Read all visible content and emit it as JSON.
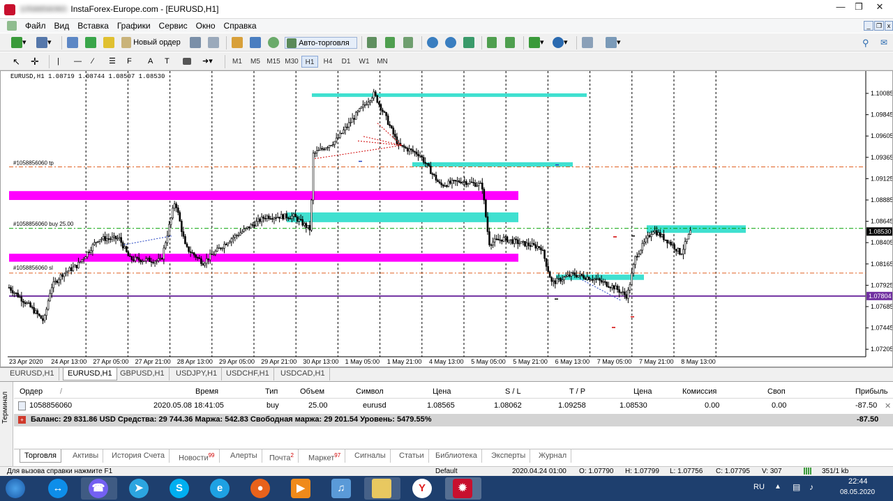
{
  "window": {
    "title": "InstaForex-Europe.com - [EURUSD,H1]",
    "account_prefix": "1058856060:"
  },
  "menu": [
    "Файл",
    "Вид",
    "Вставка",
    "Графики",
    "Сервис",
    "Окно",
    "Справка"
  ],
  "toolbar": {
    "new_order": "Новый ордер",
    "autotrade": "Авто-торговля"
  },
  "timeframes": [
    "M1",
    "M5",
    "M15",
    "M30",
    "H1",
    "H4",
    "D1",
    "W1",
    "MN"
  ],
  "active_timeframe": "H1",
  "chart": {
    "header": "EURUSD,H1  1.08719 1.08744 1.08507 1.08530",
    "price_axis": [
      "1.10085",
      "1.09845",
      "1.09605",
      "1.09365",
      "1.09125",
      "1.08885",
      "1.08645",
      "1.08405",
      "1.08165",
      "1.07925",
      "1.07685",
      "1.07445",
      "1.07205"
    ],
    "time_axis": [
      "23 Apr 2020",
      "24 Apr 13:00",
      "27 Apr 05:00",
      "27 Apr 21:00",
      "28 Apr 13:00",
      "29 Apr 05:00",
      "29 Apr 21:00",
      "30 Apr 13:00",
      "1 May 05:00",
      "1 May 21:00",
      "4 May 13:00",
      "5 May 05:00",
      "5 May 21:00",
      "6 May 13:00",
      "7 May 05:00",
      "7 May 21:00",
      "8 May 13:00"
    ],
    "current_price": "1.08530",
    "level_price": "1.07804",
    "order_tp_label": "#1058856060 tp",
    "order_buy_label": "#1058856060 buy 25.00",
    "order_sl_label": "#1058856060 sl",
    "colors": {
      "bull": "#00aa00",
      "bear": "#d00000",
      "zone_cyan": "#40e0d0",
      "zone_magenta": "#ff00ff",
      "level": "#7030a0",
      "tp_line": "#e06020",
      "entry_line": "#00a000"
    }
  },
  "chart_tabs": [
    "EURUSD,H1",
    "EURUSD,H1",
    "GBPUSD,H1",
    "USDJPY,H1",
    "USDCHF,H1",
    "USDCAD,H1"
  ],
  "active_chart_tab": 1,
  "terminal": {
    "label": "Терминал",
    "headers": {
      "order": "Ордер",
      "time": "Время",
      "type": "Тип",
      "volume": "Объем",
      "symbol": "Символ",
      "price": "Цена",
      "sl": "S / L",
      "tp": "T / P",
      "price_now": "Цена",
      "commission": "Комиссия",
      "swap": "Своп",
      "profit": "Прибыль"
    },
    "row": {
      "order": "1058856060",
      "time": "2020.05.08 18:41:05",
      "type": "buy",
      "volume": "25.00",
      "symbol": "eurusd",
      "price": "1.08565",
      "sl": "1.08062",
      "tp": "1.09258",
      "price_now": "1.08530",
      "commission": "0.00",
      "swap": "0.00",
      "profit": "-87.50"
    },
    "balance_text": "Баланс: 29 831.86 USD  Средства: 29 744.36  Маржа: 542.83  Свободная маржа: 29 201.54  Уровень: 5479.55%",
    "balance_profit": "-87.50",
    "tabs": [
      {
        "label": "Торговля",
        "badge": ""
      },
      {
        "label": "Активы",
        "badge": ""
      },
      {
        "label": "История Счета",
        "badge": ""
      },
      {
        "label": "Новости",
        "badge": "99"
      },
      {
        "label": "Алерты",
        "badge": ""
      },
      {
        "label": "Почта",
        "badge": "2"
      },
      {
        "label": "Маркет",
        "badge": "97"
      },
      {
        "label": "Сигналы",
        "badge": ""
      },
      {
        "label": "Статьи",
        "badge": ""
      },
      {
        "label": "Библиотека",
        "badge": ""
      },
      {
        "label": "Эксперты",
        "badge": ""
      },
      {
        "label": "Журнал",
        "badge": ""
      }
    ]
  },
  "status": {
    "help": "Для вызова справки нажмите F1",
    "profile": "Default",
    "time": "2020.04.24 01:00",
    "open": "O: 1.07790",
    "high": "H: 1.07799",
    "low": "L: 1.07756",
    "close": "C: 1.07795",
    "volume": "V: 307",
    "traffic": "351/1 kb"
  },
  "taskbar": {
    "lang": "RU",
    "clock": "22:44",
    "date": "08.05.2020"
  }
}
